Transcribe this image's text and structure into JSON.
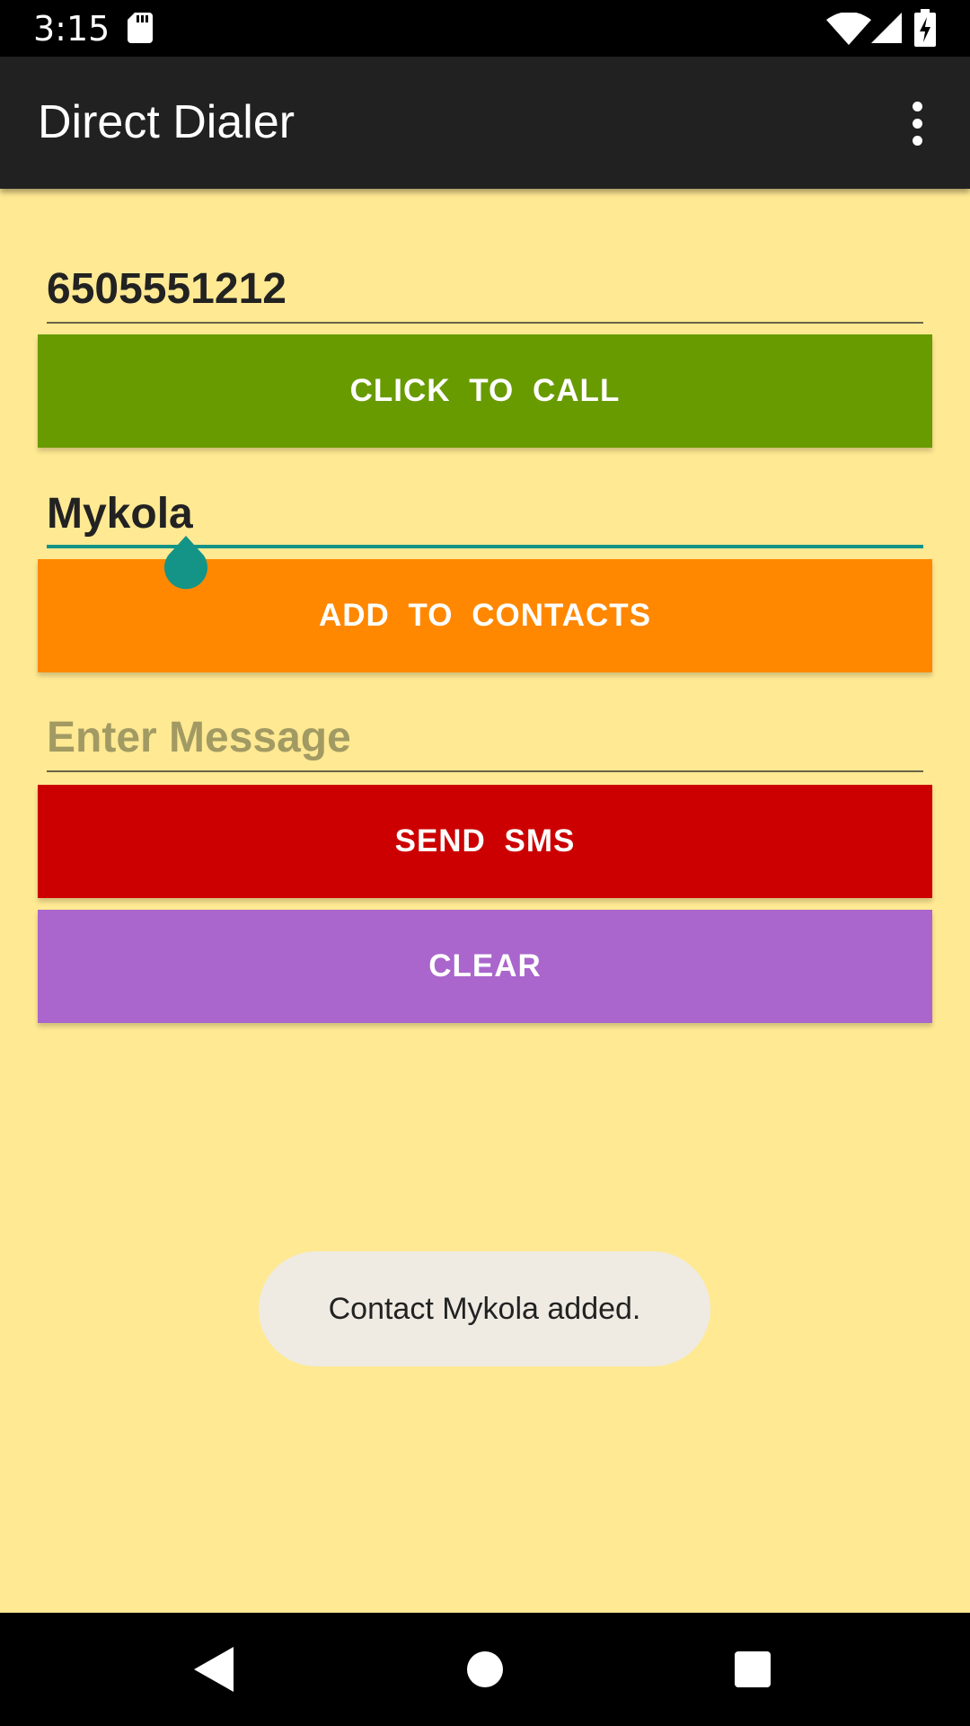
{
  "status_bar": {
    "time": "3:15"
  },
  "app_bar": {
    "title": "Direct Dialer"
  },
  "form": {
    "phone_value": "6505551212",
    "name_value": "Mykola",
    "message_placeholder": "Enter Message"
  },
  "buttons": {
    "call_label": "CLICK TO CALL",
    "add_contact_label": "ADD TO CONTACTS",
    "send_sms_label": "SEND SMS",
    "clear_label": "CLEAR"
  },
  "toast": {
    "message": "Contact Mykola added."
  },
  "colors": {
    "background": "#ffe993",
    "call_button": "#689b00",
    "add_contact_button": "#ff8800",
    "send_sms_button": "#cc0000",
    "clear_button": "#aa66cc",
    "accent": "#139487"
  },
  "icons": {
    "status": [
      "sd-card-icon",
      "wifi-icon",
      "signal-icon",
      "battery-charging-icon"
    ],
    "app_bar": [
      "more-vert-icon"
    ],
    "nav": [
      "back-icon",
      "home-icon",
      "recents-icon"
    ]
  }
}
